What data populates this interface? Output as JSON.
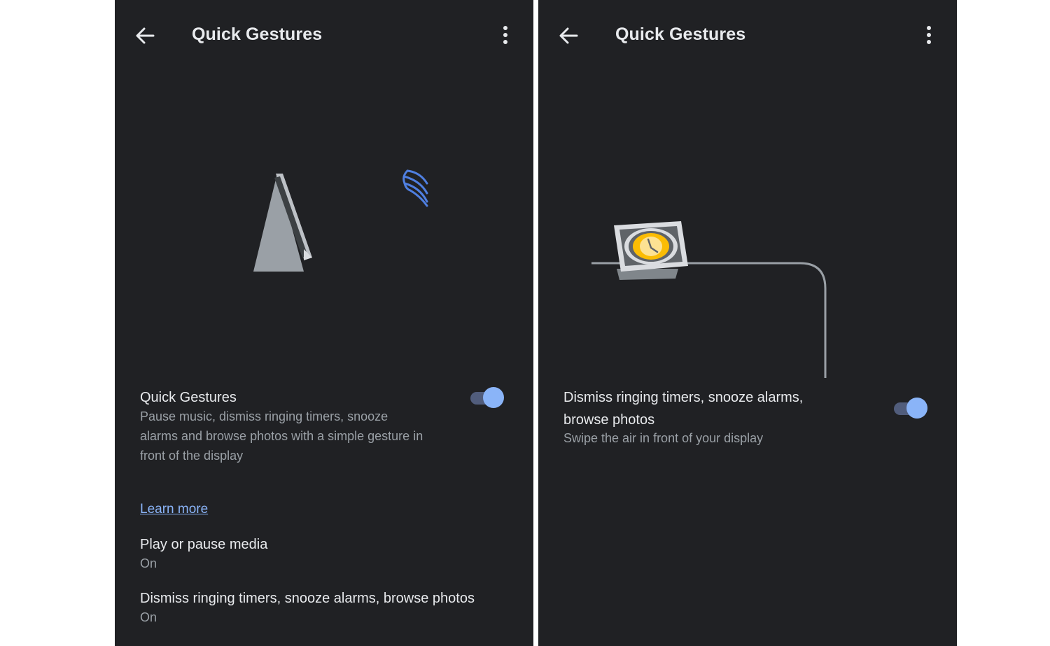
{
  "left_screen": {
    "appbar": {
      "title": "Quick Gestures"
    },
    "main_setting": {
      "title": "Quick Gestures",
      "description_lines": [
        "Pause music, dismiss ringing timers, snooze",
        "alarms and browse photos with a simple gesture in",
        "front of the display"
      ],
      "toggle_on": true
    },
    "learn_more": "Learn more",
    "items": [
      {
        "title": "Play or pause media",
        "status": "On"
      },
      {
        "title": "Dismiss ringing timers, snooze alarms, browse photos",
        "status": "On"
      }
    ]
  },
  "right_screen": {
    "appbar": {
      "title": "Quick Gestures"
    },
    "setting": {
      "title_lines": [
        "Dismiss ringing timers, snooze alarms,",
        "browse photos"
      ],
      "description": "Swipe the air in front of your display",
      "toggle_on": true
    }
  },
  "icons": {
    "back": "arrow-back-icon",
    "more": "more-vert-icon",
    "device": "nest-hub-device-icon",
    "gesture": "hand-wave-icon",
    "alarm_display": "alarm-clock-display-icon"
  },
  "colors": {
    "background": "#202124",
    "accent": "#8ab4f8",
    "toggle_track": "#515d7c",
    "text_primary": "#e8eaed",
    "text_secondary": "#9aa0a6",
    "alarm_yellow": "#fbbc04"
  }
}
